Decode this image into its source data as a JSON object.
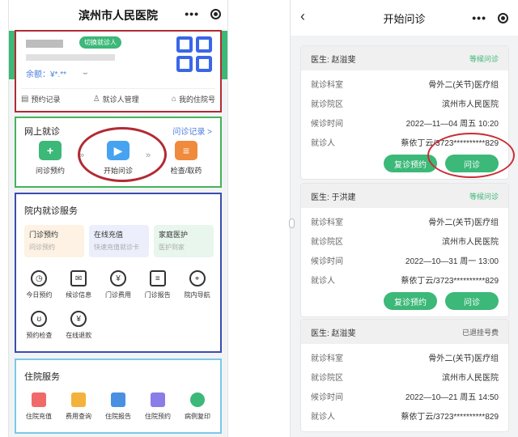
{
  "left": {
    "title": "滨州市人民医院",
    "capsule": {
      "menu": "•••"
    },
    "patient": {
      "switch_label": "切换就诊人",
      "balance": "余额：¥*.**"
    },
    "links": [
      "预约记录",
      "就诊人管理",
      "我的住院号"
    ],
    "online": {
      "heading": "网上就诊",
      "record_link": "问诊记录 >",
      "items": [
        {
          "label": "问诊预约",
          "color": "#3cb878"
        },
        {
          "label": "开始问诊",
          "color": "#45a3f0"
        },
        {
          "label": "检查/取药",
          "color": "#f08a3c"
        }
      ]
    },
    "hospital": {
      "heading": "院内就诊服务",
      "cards": [
        {
          "title": "门诊预约",
          "sub": "问诊预约",
          "bg": "#fdf2e3"
        },
        {
          "title": "在线充值",
          "sub": "快速充值就诊卡",
          "bg": "#eceffb"
        },
        {
          "title": "家庭医护",
          "sub": "医护到家",
          "bg": "#e8f6ee"
        }
      ],
      "grid": [
        {
          "label": "今日预约",
          "icon": "clock-icon",
          "glyph": "◷"
        },
        {
          "label": "候诊信息",
          "icon": "mail-icon",
          "glyph": "✉"
        },
        {
          "label": "门诊费用",
          "icon": "refresh-yen-icon",
          "glyph": "¥"
        },
        {
          "label": "门诊报告",
          "icon": "document-icon",
          "glyph": "≡"
        },
        {
          "label": "院内导航",
          "icon": "location-icon",
          "glyph": "⌖"
        },
        {
          "label": "预约检查",
          "icon": "stethoscope-icon",
          "glyph": "ʊ"
        },
        {
          "label": "在线退款",
          "icon": "refund-icon",
          "glyph": "¥"
        }
      ]
    },
    "inpatient": {
      "heading": "住院服务",
      "items": [
        {
          "label": "住院充值",
          "color": "#f06a6a"
        },
        {
          "label": "费用查询",
          "color": "#f4b23c"
        },
        {
          "label": "住院报告",
          "color": "#4a90e2"
        },
        {
          "label": "住院预约",
          "color": "#8a7de8"
        },
        {
          "label": "病例复印",
          "color": "#3cb878"
        }
      ]
    }
  },
  "right": {
    "title": "开始问诊",
    "capsule": {
      "menu": "•••"
    },
    "labels": {
      "dept": "就诊科室",
      "area": "就诊院区",
      "time": "候诊时间",
      "person": "就诊人"
    },
    "cards": [
      {
        "doctor": "医生: 赵溢斐",
        "status": "等候问诊",
        "dept": "骨外二(关节)医疗组",
        "area": "滨州市人民医院",
        "time": "2022—11—04 周五 10:20",
        "person": "蔡依丁云/3723**********829",
        "buttons": [
          "复诊预约",
          "问诊"
        ]
      },
      {
        "doctor": "医生: 于洪建",
        "status": "等候问诊",
        "dept": "骨外二(关节)医疗组",
        "area": "滨州市人民医院",
        "time": "2022—10—31 周一 13:00",
        "person": "蔡依丁云/3723**********829",
        "buttons": [
          "复诊预约",
          "问诊"
        ]
      },
      {
        "doctor": "医生: 赵溢斐",
        "status": "已退挂号费",
        "dept": "骨外二(关节)医疗组",
        "area": "滨州市人民医院",
        "time": "2022—10—21 周五 14:50",
        "person": "蔡依丁云/3723**********829"
      }
    ]
  }
}
